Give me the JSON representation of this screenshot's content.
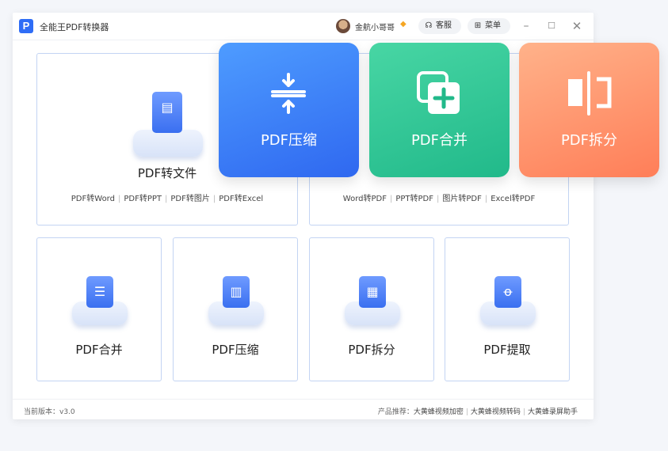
{
  "app": {
    "title": "全能王PDF转换器",
    "logo_letter": "P"
  },
  "user": {
    "name": "金航小哥哥",
    "vip_icon": "diamond-icon"
  },
  "header": {
    "help_label": "客服",
    "menu_label": "菜单"
  },
  "big_cards": [
    {
      "label": "PDF转文件",
      "links": [
        "PDF转Word",
        "PDF转PPT",
        "PDF转图片",
        "PDF转Excel"
      ]
    },
    {
      "links": [
        "Word转PDF",
        "PPT转PDF",
        "图片转PDF",
        "Excel转PDF"
      ]
    }
  ],
  "small_cards": [
    {
      "label": "PDF合并",
      "icon": "clipboard-list-icon"
    },
    {
      "label": "PDF压缩",
      "icon": "books-icon"
    },
    {
      "label": "PDF拆分",
      "icon": "folder-icon"
    },
    {
      "label": "PDF提取",
      "icon": "extract-icon"
    }
  ],
  "float_cards": [
    {
      "label": "PDF压缩",
      "icon": "compress-icon",
      "color": "#3a7bf5"
    },
    {
      "label": "PDF合并",
      "icon": "merge-icon",
      "color": "#2fc796"
    },
    {
      "label": "PDF拆分",
      "icon": "split-icon",
      "color": "#ff8e66"
    }
  ],
  "footer": {
    "version": "当前版本：v3.0",
    "recommend_prefix": "产品推荐：",
    "recommend": [
      "大黄蜂视频加密",
      "大黄蜂视频转码",
      "大黄蜂录屏助手"
    ]
  }
}
